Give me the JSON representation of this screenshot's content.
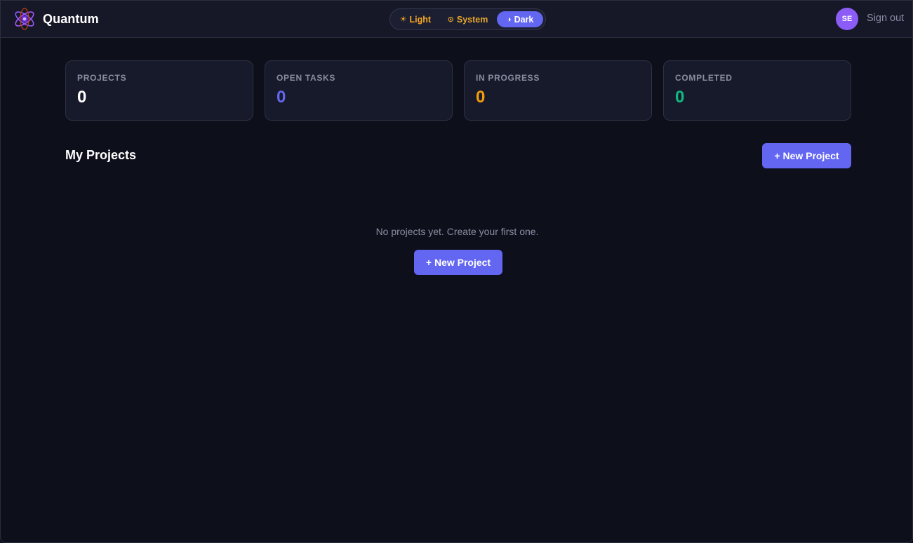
{
  "header": {
    "brand": "Quantum",
    "theme": {
      "light_label": "Light",
      "light_icon": "sun-icon",
      "system_label": "System",
      "system_icon": "system-icon",
      "dark_label": "Dark",
      "dark_icon": "half-circle-icon",
      "selected": "Dark"
    },
    "avatar_initials": "SE",
    "signout_label": "Sign out"
  },
  "stats": [
    {
      "label": "PROJECTS",
      "value": "0",
      "color": "#ffffff"
    },
    {
      "label": "OPEN TASKS",
      "value": "0",
      "color": "#6366f1"
    },
    {
      "label": "IN PROGRESS",
      "value": "0",
      "color": "#f59e0b"
    },
    {
      "label": "COMPLETED",
      "value": "0",
      "color": "#10b981"
    }
  ],
  "projects": {
    "title": "My Projects",
    "new_button_label": "+ New Project",
    "empty_message": "No projects yet. Create your first one.",
    "empty_button_label": "+ New Project"
  },
  "colors": {
    "accent": "#6366f1",
    "background": "#0d0f1a",
    "surface": "#171a2a"
  }
}
